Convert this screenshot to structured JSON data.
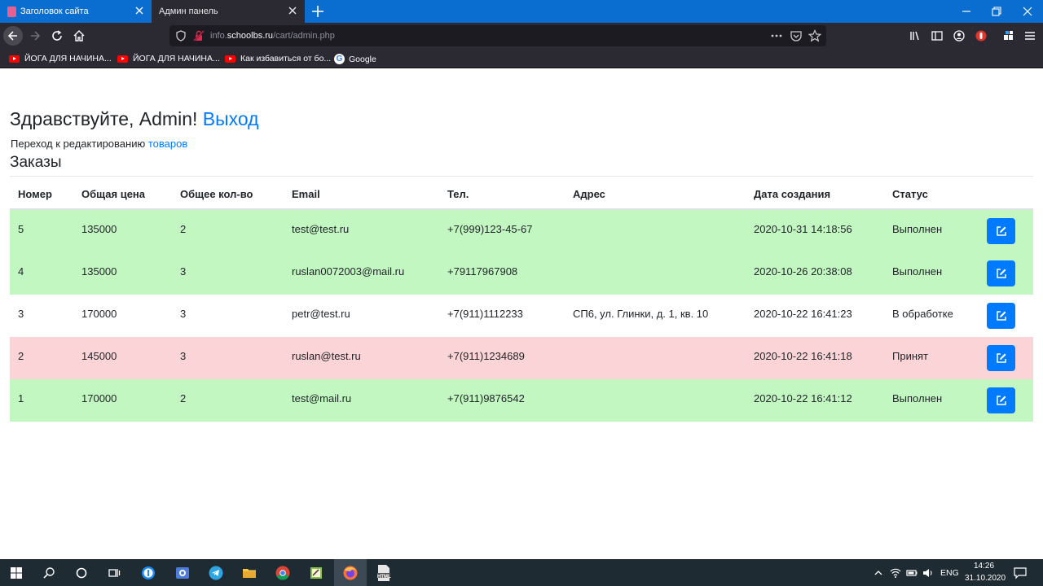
{
  "browser": {
    "tabs": [
      {
        "title": "Заголовок сайта"
      },
      {
        "title": "Админ панель"
      }
    ],
    "url": {
      "prefix": "info.",
      "domain": "schoolbs.ru",
      "path": "/cart/admin.php"
    },
    "bookmarks": [
      {
        "label": "ЙОГА ДЛЯ НАЧИНА..."
      },
      {
        "label": "ЙОГА ДЛЯ НАЧИНА..."
      },
      {
        "label": "Как избавиться от бо..."
      },
      {
        "label": "Google"
      }
    ]
  },
  "page": {
    "greeting": "Здравствуйте, Admin!",
    "logout_link": "Выход",
    "edit_prefix": "Переход к редактированию",
    "edit_link": "товаров",
    "orders_title": "Заказы",
    "columns": [
      "Номер",
      "Общая цена",
      "Общее кол-во",
      "Email",
      "Тел.",
      "Адрес",
      "Дата создания",
      "Статус"
    ],
    "orders": [
      {
        "id": "5",
        "price": "135000",
        "qty": "2",
        "email": "test@test.ru",
        "phone": "+7(999)123-45-67",
        "address": "",
        "date": "2020-10-31 14:18:56",
        "status": "Выполнен",
        "row_color": "#c3f7c2"
      },
      {
        "id": "4",
        "price": "135000",
        "qty": "3",
        "email": "ruslan0072003@mail.ru",
        "phone": "+79117967908",
        "address": "",
        "date": "2020-10-26 20:38:08",
        "status": "Выполнен",
        "row_color": "#c3f7c2"
      },
      {
        "id": "3",
        "price": "170000",
        "qty": "3",
        "email": "petr@test.ru",
        "phone": "+7(911)1112233",
        "address": "СП6, ул. Глинки, д. 1, кв. 10",
        "date": "2020-10-22 16:41:23",
        "status": "В обработке",
        "row_color": "#ffffff"
      },
      {
        "id": "2",
        "price": "145000",
        "qty": "3",
        "email": "ruslan@test.ru",
        "phone": "+7(911)1234689",
        "address": "",
        "date": "2020-10-22 16:41:18",
        "status": "Принят",
        "row_color": "#fbd4d7"
      },
      {
        "id": "1",
        "price": "170000",
        "qty": "2",
        "email": "test@mail.ru",
        "phone": "+7(911)9876542",
        "address": "",
        "date": "2020-10-22 16:41:12",
        "status": "Выполнен",
        "row_color": "#c3f7c2"
      }
    ],
    "accent_color": "#007bff"
  },
  "taskbar": {
    "language": "ENG",
    "time": "14:26",
    "date": "31.10.2020",
    "html_app_label": "HTML",
    "icons": [
      "windows-start-icon",
      "search-icon",
      "cortana-icon",
      "task-view-icon",
      "password-manager-icon",
      "screen-recorder-icon",
      "telegram-icon",
      "file-explorer-icon",
      "chrome-icon",
      "notepad-icon",
      "firefox-icon",
      "html-file-icon"
    ]
  }
}
